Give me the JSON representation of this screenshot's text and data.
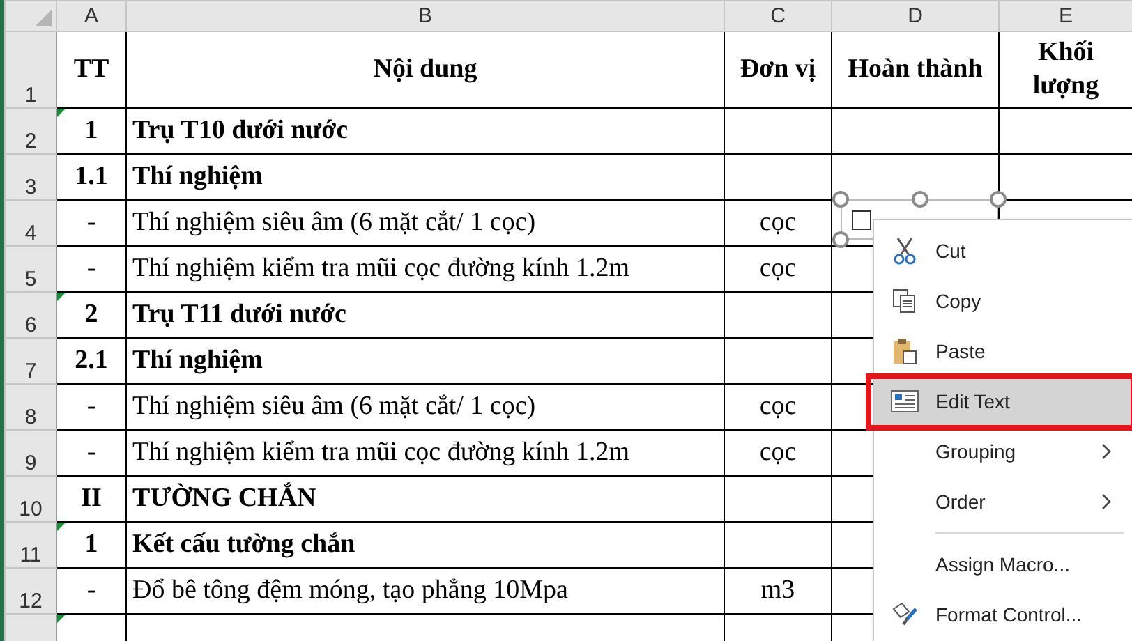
{
  "sheet": {
    "columns": [
      "A",
      "B",
      "C",
      "D",
      "E"
    ],
    "rows": [
      {
        "number": "1",
        "kind": "header",
        "flag": false,
        "tt": "TT",
        "content": "Nội dung",
        "unit": "Đơn vị",
        "done": "Hoàn thành",
        "qty": "Khối lượng"
      },
      {
        "number": "2",
        "kind": "group",
        "flag": true,
        "tt": "1",
        "content": "Trụ T10 dưới nước"
      },
      {
        "number": "3",
        "kind": "group",
        "flag": false,
        "tt": "1.1",
        "content": "Thí nghiệm"
      },
      {
        "number": "4",
        "kind": "item",
        "flag": false,
        "tt": "-",
        "content": "Thí nghiệm siêu âm (6 mặt cắt/ 1 cọc)",
        "unit": "cọc"
      },
      {
        "number": "5",
        "kind": "item",
        "flag": false,
        "tt": "-",
        "content": "Thí nghiệm kiểm tra mũi cọc đường kính 1.2m",
        "unit": "cọc"
      },
      {
        "number": "6",
        "kind": "group",
        "flag": true,
        "tt": "2",
        "content": "Trụ T11 dưới nước"
      },
      {
        "number": "7",
        "kind": "group",
        "flag": false,
        "tt": "2.1",
        "content": "Thí nghiệm"
      },
      {
        "number": "8",
        "kind": "item",
        "flag": false,
        "tt": "-",
        "content": "Thí nghiệm siêu âm (6 mặt cắt/ 1 cọc)",
        "unit": "cọc"
      },
      {
        "number": "9",
        "kind": "item",
        "flag": false,
        "tt": "-",
        "content": "Thí nghiệm kiểm tra mũi cọc đường kính 1.2m",
        "unit": "cọc"
      },
      {
        "number": "10",
        "kind": "group",
        "flag": false,
        "tt": "II",
        "content": "TƯỜNG CHẮN"
      },
      {
        "number": "11",
        "kind": "group",
        "flag": true,
        "tt": "1",
        "content": "Kết cấu tường chắn"
      },
      {
        "number": "12",
        "kind": "item",
        "flag": false,
        "tt": "-",
        "content": "Đổ bê tông đệm móng, tạo phẳng 10Mpa",
        "unit": "m3"
      },
      {
        "kind": "group",
        "flag": true
      }
    ]
  },
  "checkbox": {
    "checked": false,
    "selected": true
  },
  "context_menu": [
    {
      "kind": "cut",
      "label": "Cut",
      "selected": false,
      "submenu": false,
      "outlined": false
    },
    {
      "kind": "copy",
      "label": "Copy",
      "selected": false,
      "submenu": false,
      "outlined": false
    },
    {
      "kind": "paste",
      "label": "Paste",
      "selected": false,
      "submenu": false,
      "outlined": false
    },
    {
      "kind": "edit",
      "label": "Edit Text",
      "selected": true,
      "submenu": false,
      "outlined": true
    },
    {
      "kind": "plain",
      "label": "Grouping",
      "selected": false,
      "submenu": true,
      "outlined": false
    },
    {
      "kind": "plain",
      "label": "Order",
      "selected": false,
      "submenu": true,
      "outlined": false
    },
    {
      "kind": "separator"
    },
    {
      "kind": "plain",
      "label": "Assign Macro...",
      "selected": false,
      "submenu": false,
      "outlined": false
    },
    {
      "kind": "format",
      "label": "Format Control...",
      "selected": false,
      "submenu": false,
      "outlined": false
    }
  ]
}
